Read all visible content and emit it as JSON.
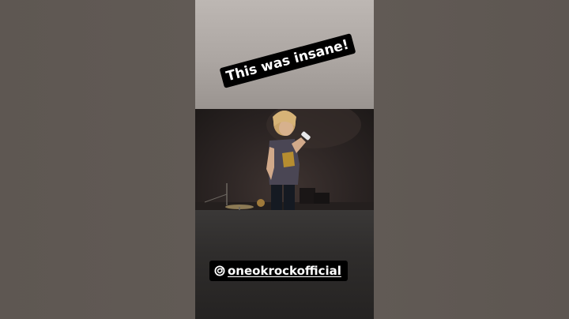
{
  "story": {
    "caption_top": "This was insane!",
    "caption_bottom": "oneokrockofficial",
    "mention_icon": "threads-icon"
  },
  "colors": {
    "side_background": "#5f5853",
    "caption_background": "#000000",
    "caption_text": "#ffffff",
    "top_panel": "#b3ada9",
    "bottom_panel": "#2f2d2c"
  }
}
